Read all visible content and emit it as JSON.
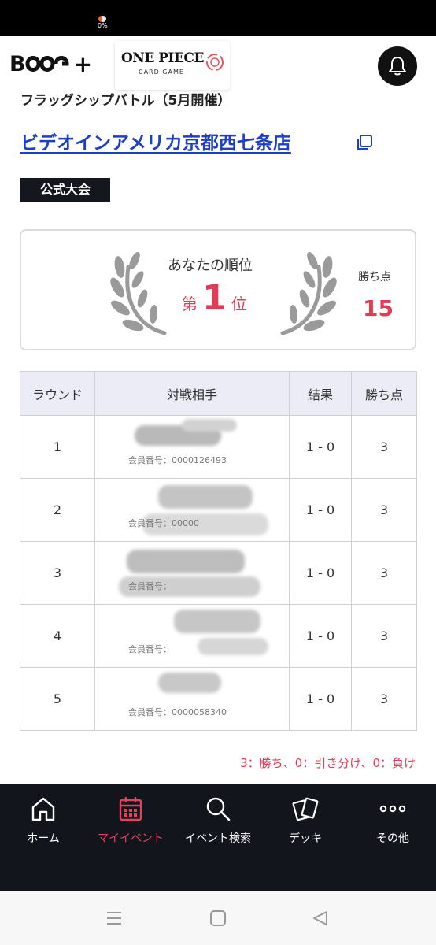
{
  "status_bar": {
    "indicator_text": "0%"
  },
  "header": {
    "brand_logo": "B",
    "brand_plus": "+",
    "game_logo_title": "ONE PIECE",
    "game_logo_sub": "CARD GAME"
  },
  "event": {
    "subtitle": "フラッグシップバトル（5月開催）",
    "store_name": "ビデオインアメリカ京都西七条店",
    "badge": "公式大会"
  },
  "rank": {
    "label": "あなたの順位",
    "prefix": "第",
    "value": "1",
    "suffix": "位",
    "points_label": "勝ち点",
    "points_value": "15"
  },
  "table": {
    "headers": [
      "ラウンド",
      "対戦相手",
      "結果",
      "勝ち点"
    ],
    "rows": [
      {
        "round": "1",
        "member": "会員番号：0000126493",
        "result": "1 - 0",
        "points": "3"
      },
      {
        "round": "2",
        "member": "会員番号：00000",
        "result": "1 - 0",
        "points": "3"
      },
      {
        "round": "3",
        "member": "会員番号：",
        "result": "1 - 0",
        "points": "3"
      },
      {
        "round": "4",
        "member": "会員番号：",
        "result": "1 - 0",
        "points": "3"
      },
      {
        "round": "5",
        "member": "会員番号：0000058340",
        "result": "1 - 0",
        "points": "3"
      }
    ]
  },
  "legend_note": "3：勝ち、0：引き分け、0：負け",
  "nav": {
    "items": [
      {
        "label": "ホーム"
      },
      {
        "label": "マイイベント"
      },
      {
        "label": "イベント検索"
      },
      {
        "label": "デッキ"
      },
      {
        "label": "その他"
      }
    ],
    "active_color": "#ea3f59"
  },
  "colors": {
    "accent": "#e23c55",
    "link": "#1c3ec9",
    "dark": "#13151d"
  }
}
